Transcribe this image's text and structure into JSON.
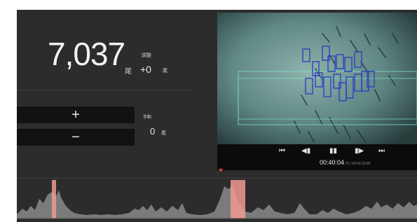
{
  "counter": {
    "total": "7,037",
    "total_label": "調整",
    "unit": "尾",
    "delta": "+0",
    "delta_unit": "尾"
  },
  "manual": {
    "plus_label": "+",
    "minus_label": "−",
    "label": "手動",
    "value": "0",
    "unit": "尾"
  },
  "player": {
    "time_current": "00:40:04",
    "time_total": ".76 / 00:42:29.80",
    "buttons": [
      "skip-to-start-icon",
      "step-back-icon",
      "pause-icon",
      "step-forward-icon",
      "skip-to-end-icon"
    ],
    "button_glyphs": [
      "⏮",
      "◀▮",
      "▮▮",
      "▮▶",
      "⏭"
    ]
  },
  "colors": {
    "background": "#2c2c2c",
    "button_bg": "#121212",
    "video_tint": "#5f8784",
    "detection_box": "#2a3bbf",
    "roi_line": "#7fe0c2",
    "timeline_fill": "#8a8a8a",
    "timeline_highlight": "#f09a90",
    "playhead": "#e0404a"
  }
}
